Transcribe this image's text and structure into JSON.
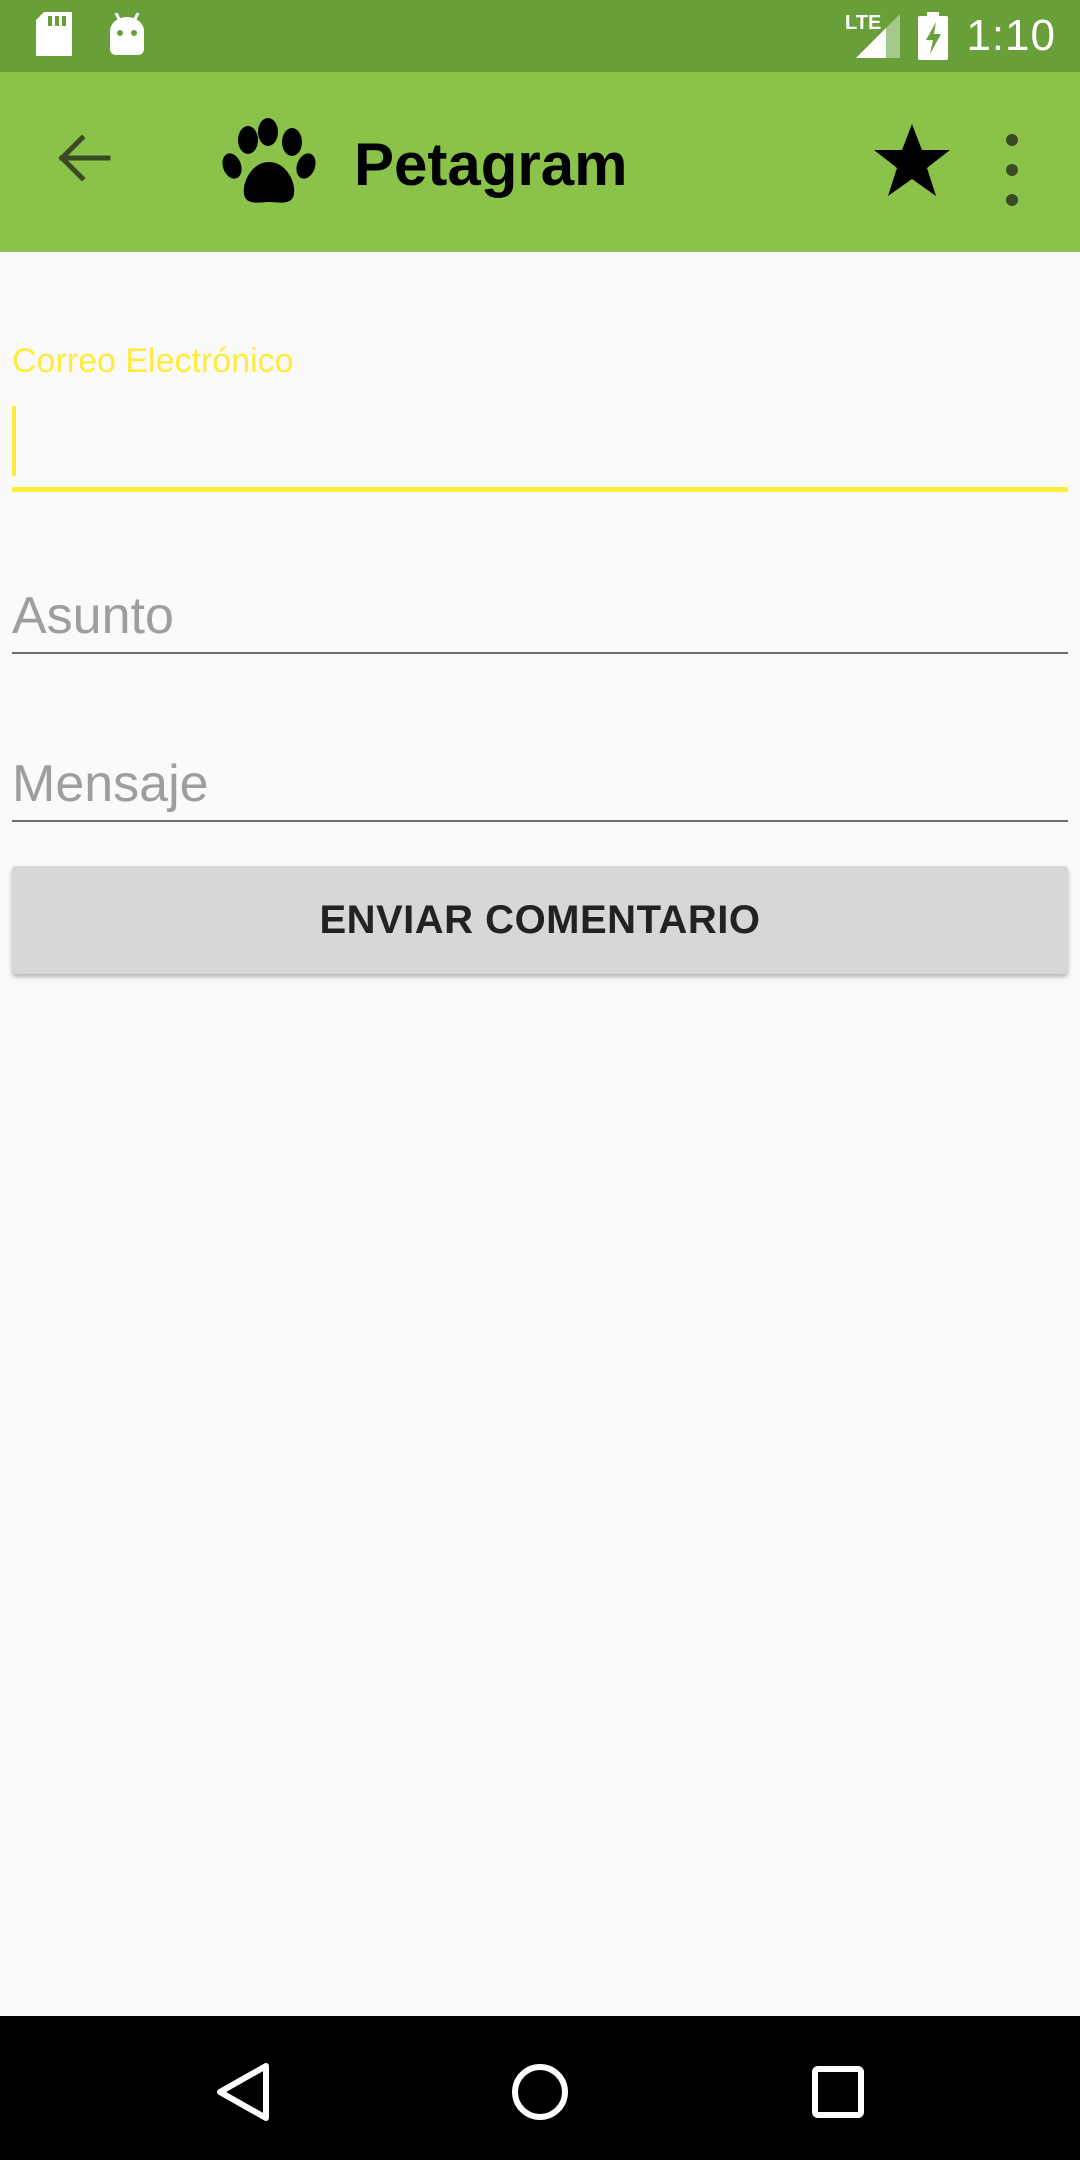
{
  "status_bar": {
    "time": "1:10",
    "network": "LTE",
    "icons": [
      "sd-card-icon",
      "android-icon",
      "signal-icon",
      "battery-charging-icon"
    ]
  },
  "app_bar": {
    "title": "Petagram",
    "icons": [
      "back-arrow-icon",
      "paw-icon",
      "star-icon",
      "overflow-menu-icon"
    ]
  },
  "form": {
    "email_label": "Correo Electrónico",
    "email_value": "",
    "subject_placeholder": "Asunto",
    "message_placeholder": "Mensaje",
    "submit_label": "ENVIAR COMENTARIO"
  },
  "nav_bar": {
    "icons": [
      "nav-back-icon",
      "nav-home-icon",
      "nav-recents-icon"
    ]
  },
  "colors": {
    "status_bar": "#689f38",
    "app_bar": "#8bc34a",
    "accent": "#ffeb3b",
    "background": "#fafafa",
    "button": "#d6d7d7"
  }
}
